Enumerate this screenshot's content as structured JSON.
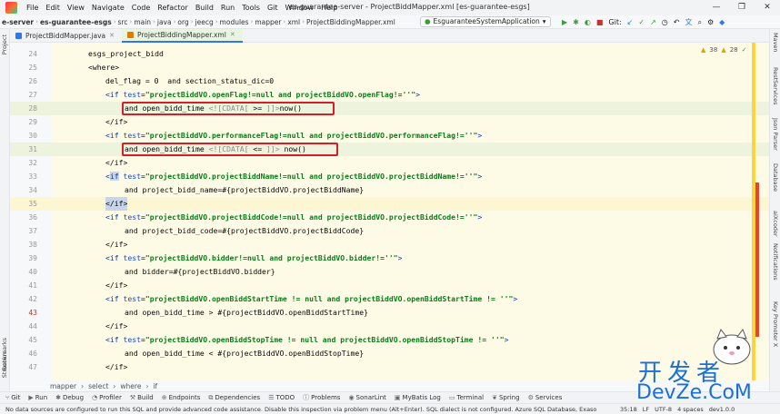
{
  "window": {
    "title": "es-guarantee-server - ProjectBiddMapper.xml [es-guarantee-esgs]",
    "menu": [
      "File",
      "Edit",
      "View",
      "Navigate",
      "Code",
      "Refactor",
      "Build",
      "Run",
      "Tools",
      "Git",
      "Window",
      "Help"
    ],
    "controls": [
      "—",
      "❐",
      "✕"
    ]
  },
  "navbar": {
    "crumbs": [
      "e-server",
      "es-guarantee-esgs",
      "src",
      "main",
      "java",
      "org",
      "jeecg",
      "modules",
      "mapper",
      "xml",
      "ProjectBiddingMapper.xml"
    ],
    "run_config": "EsguaranteeSystemApplication",
    "git_label": "Git:"
  },
  "tabs": [
    {
      "label": "ProjectBiddMapper.java",
      "icon_color": "#3574f0"
    },
    {
      "label": "ProjectBiddingMapper.xml",
      "icon_color": "#e07b00"
    }
  ],
  "editor": {
    "warnings": "38",
    "weak_warnings": "28",
    "lines": [
      {
        "num": "24",
        "text": "esgs_project_bidd"
      },
      {
        "num": "25",
        "text": "<where>"
      },
      {
        "num": "26",
        "text": "del_flag = 0  and section_status_dic=0"
      },
      {
        "num": "27",
        "tag": "if",
        "attr": "test",
        "value": "\"projectBiddVO.openFlag!=null and projectBiddVO.openFlag!=''\""
      },
      {
        "num": "28",
        "pre": "and open_bidd_time ",
        "cdata_open": "<![CDATA[",
        "cdata_body": " >= ",
        "cdata_close": "]]>",
        "post": "now()"
      },
      {
        "num": "29",
        "text": "</if>"
      },
      {
        "num": "30",
        "tag": "if",
        "attr": "test",
        "value": "\"projectBiddVO.performanceFlag!=null and projectBiddVO.performanceFlag!=''\""
      },
      {
        "num": "31",
        "pre": "and open_bidd_time ",
        "cdata_open": "<![CDATA[",
        "cdata_body": " <= ",
        "cdata_close": "]]>",
        "post": " now()"
      },
      {
        "num": "32",
        "text": "</if>"
      },
      {
        "num": "33",
        "tag": "if",
        "attr": "test",
        "value": "\"projectBiddVO.projectBiddName!=null and projectBiddVO.projectBiddName!=''\""
      },
      {
        "num": "34",
        "text": "and project_bidd_name=#{projectBiddVO.projectBiddName}"
      },
      {
        "num": "35",
        "text": "</if>"
      },
      {
        "num": "36",
        "tag": "if",
        "attr": "test",
        "value": "\"projectBiddVO.projectBiddCode!=null and projectBiddVO.projectBiddCode!=''\""
      },
      {
        "num": "37",
        "text": "and project_bidd_code=#{projectBiddVO.projectBiddCode}"
      },
      {
        "num": "38",
        "text": "</if>"
      },
      {
        "num": "39",
        "tag": "if",
        "attr": "test",
        "value": "\"projectBiddVO.bidder!=null and projectBiddVO.bidder!=''\""
      },
      {
        "num": "40",
        "text": "and bidder=#{projectBiddVO.bidder}"
      },
      {
        "num": "41",
        "text": "</if>"
      },
      {
        "num": "42",
        "tag": "if",
        "attr": "test",
        "value": "\"projectBiddVO.openBiddStartTime != null and projectBiddVO.openBiddStartTime != ''\""
      },
      {
        "num": "43",
        "text": "and open_bidd_time > #{projectBiddVO.openBiddStartTime}"
      },
      {
        "num": "44",
        "text": "</if>"
      },
      {
        "num": "45",
        "tag": "if",
        "attr": "test",
        "value": "\"projectBiddVO.openBiddStopTime != null and projectBiddVO.openBiddStopTime != ''\""
      },
      {
        "num": "46",
        "text": "and open_bidd_time < #{projectBiddVO.openBiddStopTime}"
      },
      {
        "num": "47",
        "text": "</if>"
      }
    ]
  },
  "editor_breadcrumb": [
    "mapper",
    "select",
    "where",
    "if"
  ],
  "left_tools": [
    "Project",
    "Bookmarks",
    "Structure"
  ],
  "right_tools": [
    "Maven",
    "RestServices",
    "Json Parser",
    "Database",
    "aiXcoder",
    "Notifications",
    "Key Promoter X"
  ],
  "tool_windows": [
    "Git",
    "Run",
    "Debug",
    "Profiler",
    "Build",
    "Endpoints",
    "Dependencies",
    "TODO",
    "Problems",
    "SonarLint",
    "MyBatis Log",
    "Terminal",
    "Spring",
    "Services"
  ],
  "status": {
    "message": "No data sources are configured to run this SQL and provide advanced code assistance. Disable this inspection via problem menu (Alt+Enter). SQL dialect is not configured. Azure SQL Database, Exaso",
    "position": "35:18",
    "line_sep": "LF",
    "encoding": "UTF-8",
    "indent": "4 spaces",
    "branch": "dev1.0.0"
  },
  "watermark": {
    "zh": "开发者",
    "en": "DevZe.CoM"
  }
}
